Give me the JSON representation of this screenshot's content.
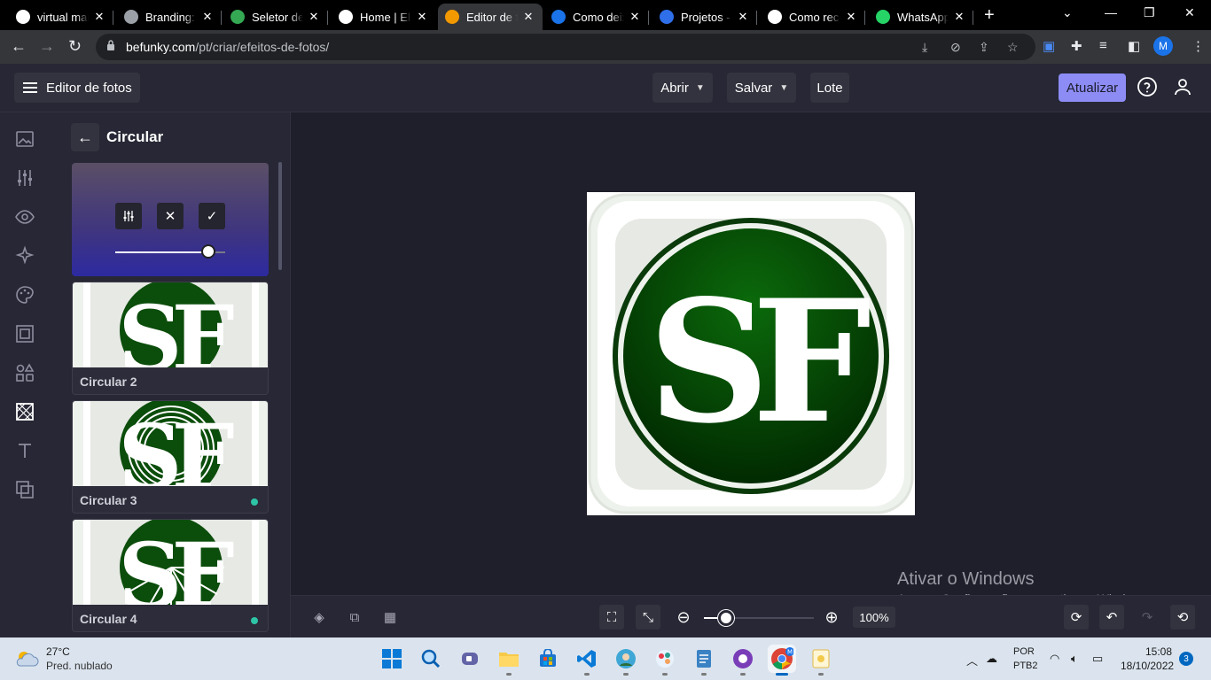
{
  "browser": {
    "tabs": [
      {
        "title": "virtual mar",
        "favicon": "google-icon",
        "color": "#ffffff"
      },
      {
        "title": "Branding: c",
        "favicon": "image-icon",
        "color": "#9aa0a6"
      },
      {
        "title": "Seletor de",
        "favicon": "drive-icon",
        "color": "#34a853"
      },
      {
        "title": "Home | Ele",
        "favicon": "elementor-icon",
        "color": "#ffffff"
      },
      {
        "title": "Editor de f",
        "favicon": "befunky-icon",
        "color": "#f29900"
      },
      {
        "title": "Como deix",
        "favicon": "tecmundo-icon",
        "color": "#1a73e8"
      },
      {
        "title": "Projetos - ",
        "favicon": "canva-icon",
        "color": "#2f6fea"
      },
      {
        "title": "Como reco",
        "favicon": "globe-icon",
        "color": "#ffffff"
      },
      {
        "title": "WhatsApp",
        "favicon": "whatsapp-icon",
        "color": "#25d366"
      }
    ],
    "url_domain": "befunky.com",
    "url_path": "/pt/criar/efeitos-de-fotos/",
    "profile_initial": "M"
  },
  "app": {
    "menu_label": "Editor de fotos",
    "open_label": "Abrir",
    "save_label": "Salvar",
    "batch_label": "Lote",
    "upgrade_label": "Atualizar",
    "accent": "#8c8cf4"
  },
  "panel": {
    "title": "Circular",
    "slider_value": 0.85,
    "presets": [
      {
        "label": "Circular 2",
        "badge": false
      },
      {
        "label": "Circular 3",
        "badge": true
      },
      {
        "label": "Circular 4",
        "badge": true
      }
    ],
    "badge_color": "#2ec4a6"
  },
  "canvas": {
    "logo_letters": "SF",
    "logo_color": "#0b5a0b"
  },
  "bottom": {
    "zoom_label": "100%",
    "zoom_fraction": 0.2
  },
  "watermark": {
    "line1": "Ativar o Windows",
    "line2": "Acesse Configurações para ativar o Windows."
  },
  "taskbar": {
    "temp": "27°C",
    "weather": "Pred. nublado",
    "lang1": "POR",
    "lang2": "PTB2",
    "time": "15:08",
    "date": "18/10/2022",
    "notifications": "3"
  }
}
